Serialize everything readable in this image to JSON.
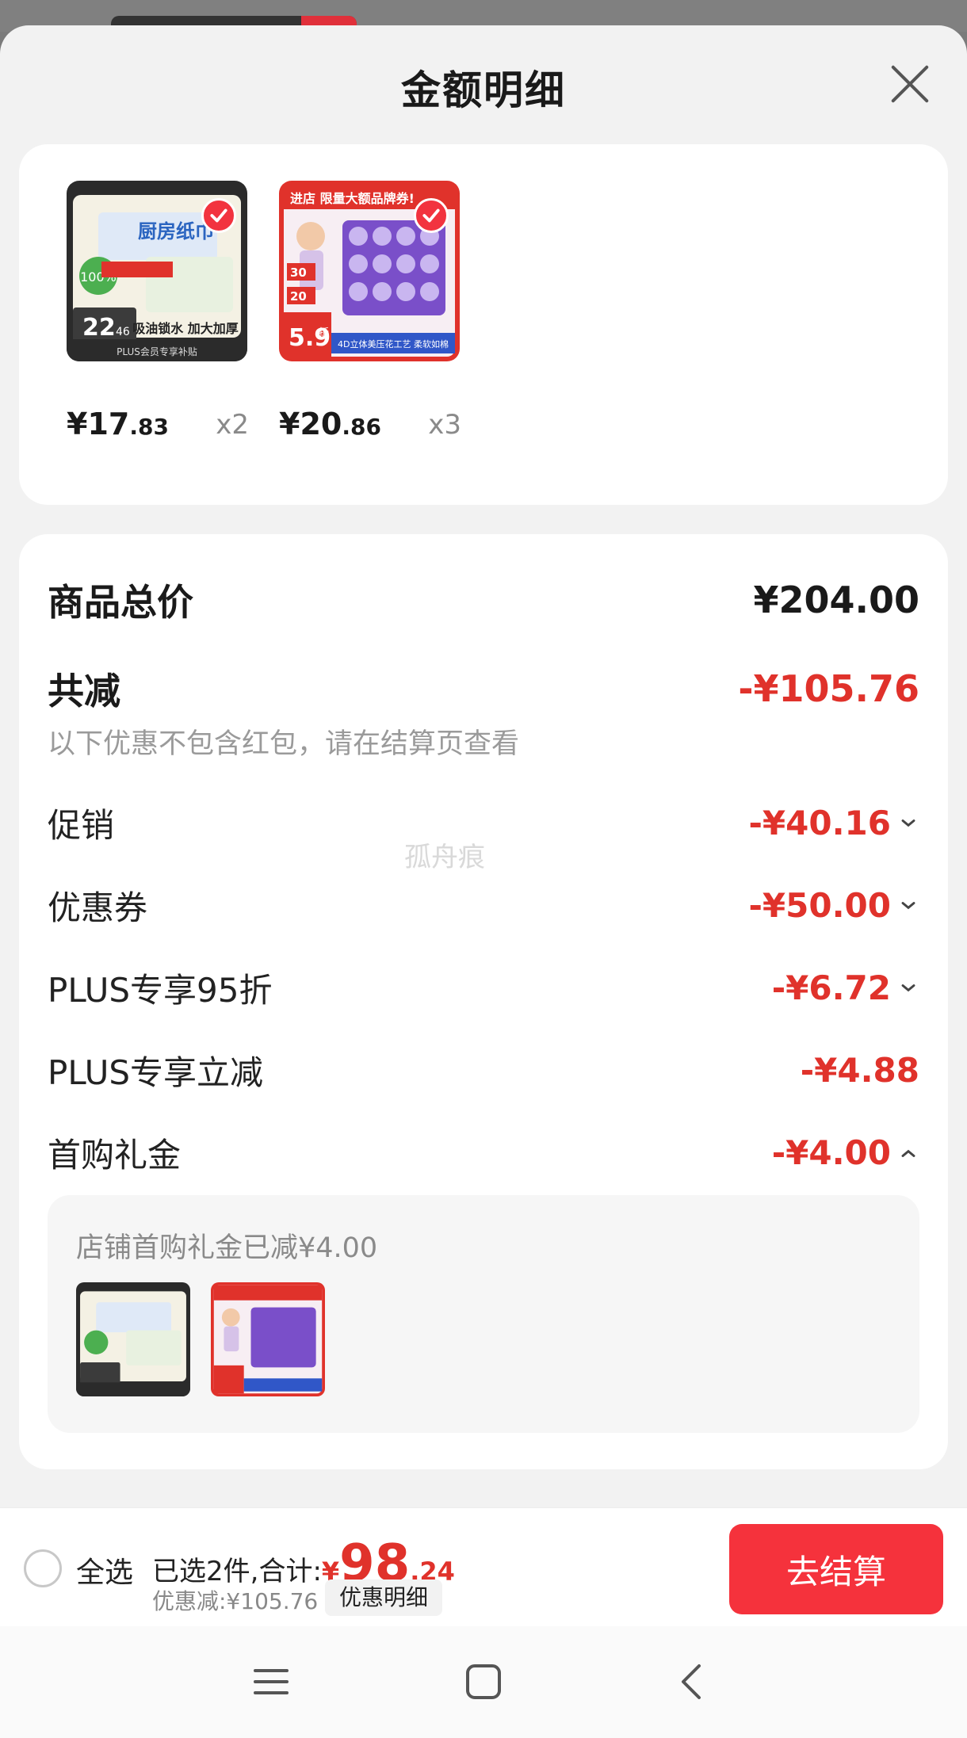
{
  "sheet": {
    "title": "金额明细"
  },
  "products": [
    {
      "price_int": "¥17",
      "price_dec": ".83",
      "qty": "x2",
      "selected": true
    },
    {
      "price_int": "¥20",
      "price_dec": ".86",
      "qty": "x3",
      "selected": true
    }
  ],
  "product_images": {
    "p1": {
      "banner": "厨房纸巾",
      "price_badge_int": "22",
      "price_badge_dec": "46",
      "slogan": "吸油锁水 加大加厚",
      "footer": "PLUS会员专享补贴"
    },
    "p2": {
      "banner": "进店 限量大额品牌券!",
      "badge_top": "30",
      "badge_mid": "20",
      "price_big": "5.9",
      "price_unit": "折",
      "caption": "4D立体美压花工艺 柔软如棉"
    }
  },
  "detail": {
    "total_label": "商品总价",
    "total_value": "¥204.00",
    "reduce_label": "共减",
    "reduce_value": "-¥105.76",
    "note": "以下优惠不包含红包，请在结算页查看",
    "items": [
      {
        "label": "促销",
        "value": "-¥40.16",
        "chevron": "down"
      },
      {
        "label": "优惠券",
        "value": "-¥50.00",
        "chevron": "down"
      },
      {
        "label": "PLUS专享95折",
        "value": "-¥6.72",
        "chevron": "down"
      },
      {
        "label": "PLUS专享立减",
        "value": "-¥4.88",
        "chevron": "none"
      },
      {
        "label": "首购礼金",
        "value": "-¥4.00",
        "chevron": "up"
      }
    ],
    "gift_note": "店铺首购礼金已减¥4.00"
  },
  "watermark": "孤舟痕",
  "bottom_bar": {
    "select_all": "全选",
    "summary_prefix": "已选2件,合计:",
    "total_currency": "¥",
    "total_int": "98",
    "total_dec": ".24",
    "discount_text": "优惠减:¥105.76",
    "detail_chip": "优惠明细",
    "checkout": "去结算"
  },
  "nav": {
    "icons": [
      "menu-icon",
      "home-square-icon",
      "back-chevron-icon"
    ]
  },
  "colors": {
    "accent_red": "#e0322b",
    "button_red": "#f5323c",
    "sheet_bg": "#f2f2f2"
  }
}
